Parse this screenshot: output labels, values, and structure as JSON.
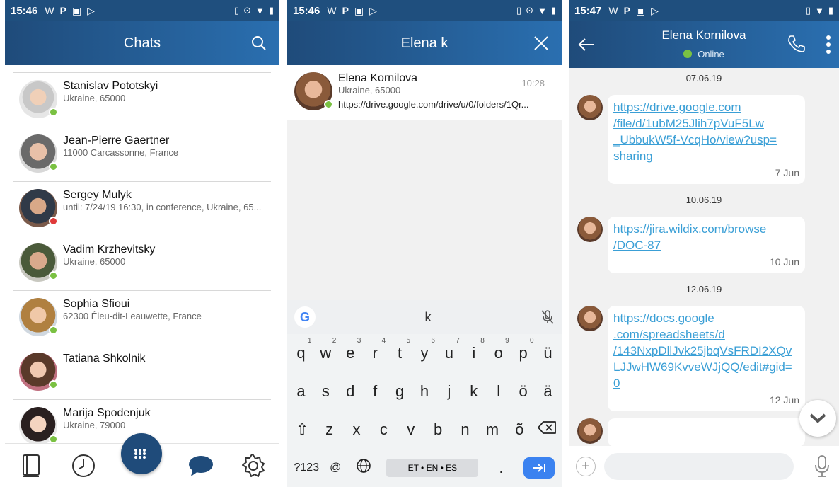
{
  "panel1": {
    "status": {
      "time": "15:46",
      "icons": [
        "W",
        "P",
        "▣",
        "▷"
      ]
    },
    "title": "Chats",
    "contacts": [
      {
        "name": "Stanislav Pototskyi",
        "sub": "Ukraine, 65000",
        "status": "online"
      },
      {
        "name": "Jean-Pierre Gaertner",
        "sub": "11000 Carcassonne, France",
        "status": "online"
      },
      {
        "name": "Sergey Mulyk",
        "sub": "until: 7/24/19 16:30, in conference, Ukraine, 65...",
        "status": "busy"
      },
      {
        "name": "Vadim Krzhevitsky",
        "sub": "Ukraine, 65000",
        "status": "online"
      },
      {
        "name": "Sophia Sfioui",
        "sub": "62300 Éleu-dit-Leauwette, France",
        "status": "online"
      },
      {
        "name": "Tatiana Shkolnik",
        "sub": "",
        "status": "online"
      },
      {
        "name": "Marija Spodenjuk",
        "sub": "Ukraine, 79000",
        "status": "online"
      }
    ],
    "tabs": [
      "phonebook-icon",
      "history-icon",
      "dialpad-icon",
      "chat-icon",
      "settings-icon"
    ]
  },
  "panel2": {
    "status": {
      "time": "15:46",
      "icons": [
        "W",
        "P",
        "▣",
        "▷"
      ]
    },
    "search_text": "Elena k",
    "result": {
      "name": "Elena Kornilova",
      "sub": "Ukraine, 65000",
      "time": "10:28",
      "preview": "https://drive.google.com/drive/u/0/folders/1Qr..."
    },
    "keyboard": {
      "suggestion": "k",
      "row1": [
        {
          "k": "q",
          "n": "1"
        },
        {
          "k": "w",
          "n": "2"
        },
        {
          "k": "e",
          "n": "3"
        },
        {
          "k": "r",
          "n": "4"
        },
        {
          "k": "t",
          "n": "5"
        },
        {
          "k": "y",
          "n": "6"
        },
        {
          "k": "u",
          "n": "7"
        },
        {
          "k": "i",
          "n": "8"
        },
        {
          "k": "o",
          "n": "9"
        },
        {
          "k": "p",
          "n": "0"
        },
        {
          "k": "ü",
          "n": ""
        }
      ],
      "row2": [
        "a",
        "s",
        "d",
        "f",
        "g",
        "h",
        "j",
        "k",
        "l",
        "ö",
        "ä"
      ],
      "row3": [
        "z",
        "x",
        "c",
        "v",
        "b",
        "n",
        "m",
        "õ"
      ],
      "sym_label": "?123",
      "at_label": "@",
      "space_label": "ET • EN • ES",
      "period_label": "."
    }
  },
  "panel3": {
    "status": {
      "time": "15:47",
      "icons": [
        "W",
        "P",
        "▣",
        "▷"
      ]
    },
    "contact_name": "Elena Kornilova",
    "contact_status": "Online",
    "messages": [
      {
        "date": "07.06.19",
        "link": "https://drive.google.com/file/d/1ubM25Jlih7pVuF5Lw_UbbukW5f-VcqHo/view?usp=sharing",
        "lines": [
          "https://drive.google.com",
          "/file/d/1ubM25Jlih7pVuF5Lw",
          "_UbbukW5f-VcqHo/view?usp=",
          "sharing"
        ],
        "time": "7 Jun"
      },
      {
        "date": "10.06.19",
        "link": "https://jira.wildix.com/browse/DOC-87",
        "lines": [
          "https://jira.wildix.com/browse",
          "/DOC-87"
        ],
        "time": "10 Jun"
      },
      {
        "date": "12.06.19",
        "link": "https://docs.google.com/spreadsheets/d/143NxpDllJvk25jbqVsFRDI2XQvLJJwHW69KvveWJjQQ/edit#gid=0",
        "lines": [
          "https://docs.google",
          ".com/spreadsheets/d",
          "/143NxpDllJvk25jbqVsFRDI2XQv",
          "LJJwHW69KvveWJjQQ/edit#gid=",
          "0"
        ],
        "time": "12 Jun"
      }
    ]
  },
  "colors": {
    "header_dark": "#1f4b7a",
    "header_light": "#2a6fb0",
    "online": "#7ac142",
    "busy": "#e03a3a",
    "link": "#3a9fd6"
  }
}
